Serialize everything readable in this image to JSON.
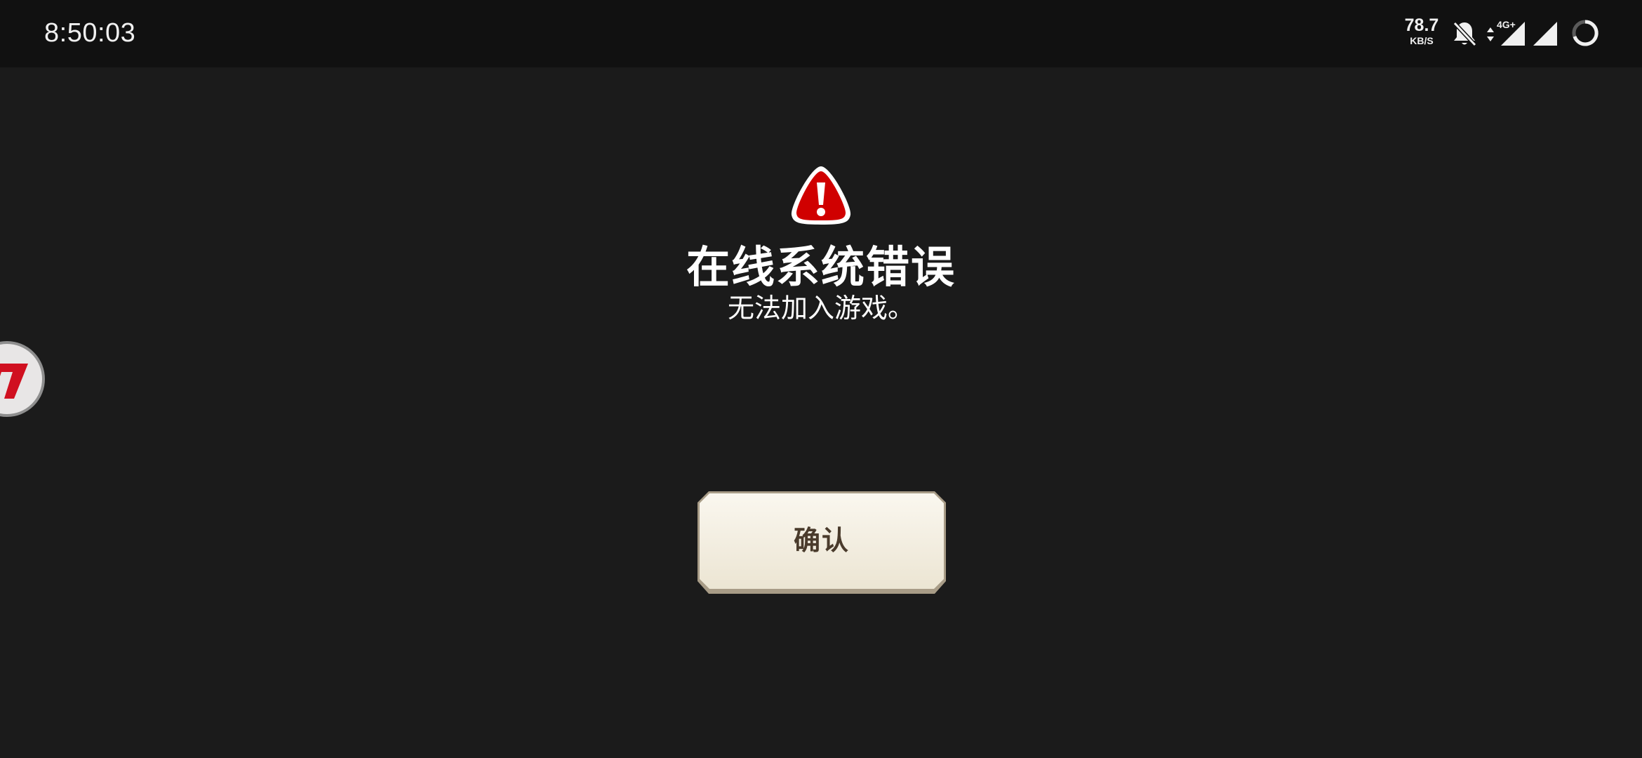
{
  "status_bar": {
    "time": "8:50:03",
    "net_speed_value": "78.7",
    "net_speed_unit": "KB/S",
    "network_type": "4G+",
    "icons": [
      "bell-off-icon",
      "data-arrows-icon",
      "signal-4g-icon",
      "signal-icon",
      "loading-ring-icon"
    ]
  },
  "overlay": {
    "icon": "floating-app-badge-icon"
  },
  "dialog": {
    "icon": "warning-exclamation-icon",
    "title": "在线系统错误",
    "message": "无法加入游戏。",
    "confirm_label": "确认"
  },
  "colors": {
    "background": "#1b1b1b",
    "status_bar": "#111111",
    "warning_red": "#d00000",
    "button_face": "#f3efe3",
    "button_border": "#a89c87",
    "button_text": "#4a3b2c"
  }
}
